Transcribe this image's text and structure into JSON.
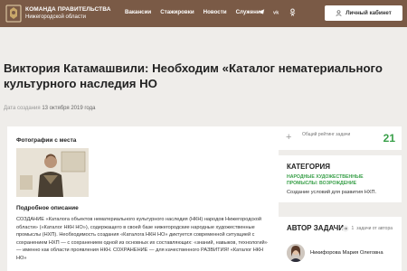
{
  "header": {
    "brand_line1": "КОМАНДА ПРАВИТЕЛЬСТВА",
    "brand_line2": "Нижегородской области",
    "nav": [
      "Вакансии",
      "Стажировки",
      "Новости",
      "Служение"
    ],
    "social_icons": [
      "telegram-icon",
      "vk-icon",
      "ok-icon"
    ],
    "cabinet_label": "Личный кабинет"
  },
  "article": {
    "title": "Виктория Катамашвили: Необходим «Каталог нематериального культурного наследия НО",
    "created_label": "Дата создания",
    "created_date": "13 октября 2019 года"
  },
  "main": {
    "photos_heading": "Фотографии с места",
    "desc_heading": "Подробное описание",
    "description": "СОЗДАНИЕ «Каталога объектов нематериального культурного наследия (НКН) народов Нижегородской области» («Каталог НКН НО»), содержащего в своей базе нижегородские народные художественные промыслы (НХП). Необходимость создания «Каталога НКН НО» диктуется современной ситуацией с сохранением НХП — с сохранением одной из основных их составляющих: «знаний, навыков, технологий» — именно как области проявления НКН. СОХРАНЕНИЕ — для качественного РАЗВИТИЯ! «Каталог НКН НО»"
  },
  "rating": {
    "label": "Общий рейтинг задачи",
    "value": "21"
  },
  "category": {
    "heading": "КАТЕГОРИЯ",
    "subheading": "НАРОДНЫЕ ХУДОЖЕСТВЕННЫЕ ПРОМЫСЛЫ: ВОЗРОЖДЕНИЕ",
    "item": "Создание условий для развития НХП."
  },
  "author": {
    "heading": "АВТОР ЗАДАЧИ",
    "count_label": "задачи от автора",
    "count_value": "1",
    "name": "Никифорова Мария Олеговна"
  },
  "colors": {
    "header_bg": "#7a5a46",
    "accent_green": "#3aa04a",
    "page_bg": "#efedea"
  }
}
